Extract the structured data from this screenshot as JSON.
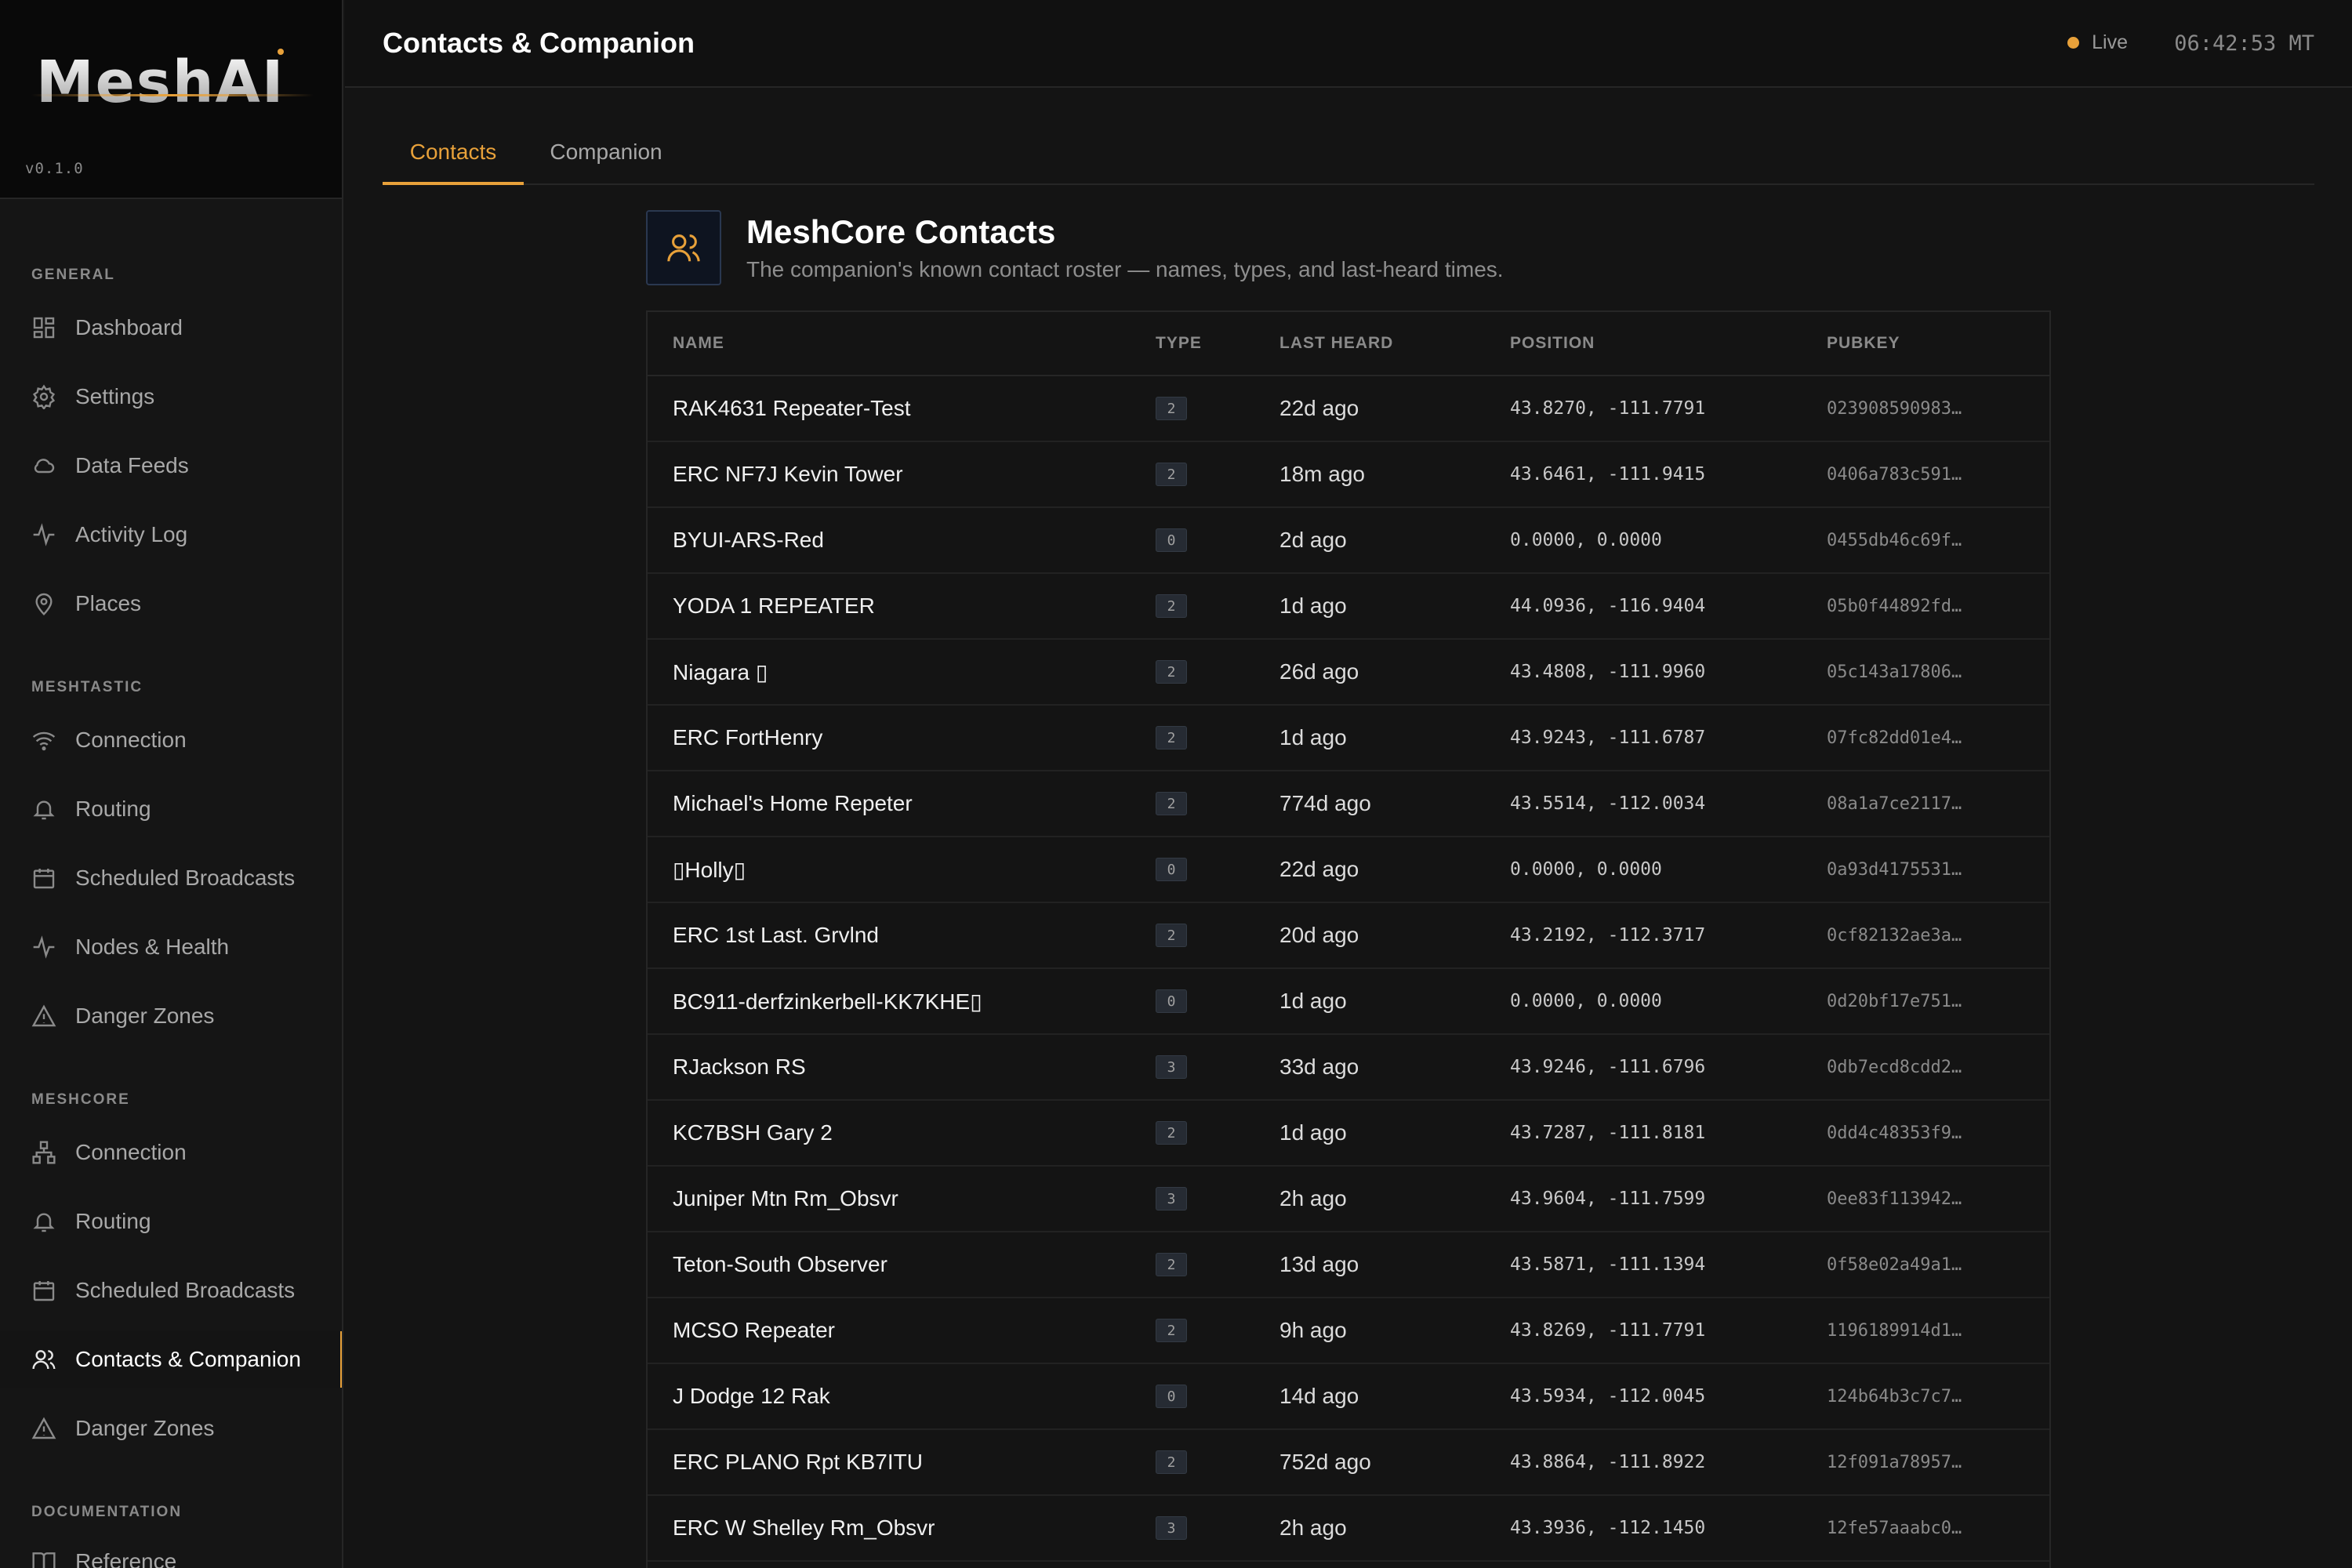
{
  "app": {
    "logo_text": "MeshAI",
    "version": "v0.1.0"
  },
  "sidebar": {
    "sections": [
      {
        "label": "GENERAL",
        "items": [
          {
            "label": "Dashboard",
            "icon": "grid-icon"
          },
          {
            "label": "Settings",
            "icon": "gear-icon"
          },
          {
            "label": "Data Feeds",
            "icon": "cloud-icon"
          },
          {
            "label": "Activity Log",
            "icon": "activity-icon"
          },
          {
            "label": "Places",
            "icon": "map-pin-icon"
          }
        ]
      },
      {
        "label": "MESHTASTIC",
        "items": [
          {
            "label": "Connection",
            "icon": "wifi-icon"
          },
          {
            "label": "Routing",
            "icon": "bell-icon"
          },
          {
            "label": "Scheduled Broadcasts",
            "icon": "calendar-icon"
          },
          {
            "label": "Nodes & Health",
            "icon": "activity-icon"
          },
          {
            "label": "Danger Zones",
            "icon": "warning-icon"
          }
        ]
      },
      {
        "label": "MESHCORE",
        "items": [
          {
            "label": "Connection",
            "icon": "network-icon"
          },
          {
            "label": "Routing",
            "icon": "bell-icon"
          },
          {
            "label": "Scheduled Broadcasts",
            "icon": "calendar-icon"
          },
          {
            "label": "Contacts & Companion",
            "icon": "users-icon",
            "active": true
          },
          {
            "label": "Danger Zones",
            "icon": "warning-icon"
          }
        ]
      },
      {
        "label": "DOCUMENTATION",
        "items": [
          {
            "label": "Reference",
            "icon": "book-icon"
          }
        ]
      }
    ]
  },
  "header": {
    "title": "Contacts & Companion",
    "status": "Live",
    "clock": "06:42:53 MT"
  },
  "tabs": [
    {
      "label": "Contacts",
      "active": true
    },
    {
      "label": "Companion",
      "active": false
    }
  ],
  "section": {
    "title": "MeshCore Contacts",
    "subtitle": "The companion's known contact roster — names, types, and last-heard times."
  },
  "table": {
    "columns": [
      "NAME",
      "TYPE",
      "LAST HEARD",
      "POSITION",
      "PUBKEY"
    ],
    "rows": [
      {
        "name": "RAK4631 Repeater-Test",
        "type": "2",
        "heard": "22d ago",
        "position": "43.8270, -111.7791",
        "pubkey": "023908590983…"
      },
      {
        "name": "ERC NF7J Kevin Tower",
        "type": "2",
        "heard": "18m ago",
        "position": "43.6461, -111.9415",
        "pubkey": "0406a783c591…"
      },
      {
        "name": "BYUI-ARS-Red",
        "type": "0",
        "heard": "2d ago",
        "position": "0.0000, 0.0000",
        "pubkey": "0455db46c69f…"
      },
      {
        "name": "YODA 1 REPEATER",
        "type": "2",
        "heard": "1d ago",
        "position": "44.0936, -116.9404",
        "pubkey": "05b0f44892fd…"
      },
      {
        "name": "Niagara ▯",
        "type": "2",
        "heard": "26d ago",
        "position": "43.4808, -111.9960",
        "pubkey": "05c143a17806…"
      },
      {
        "name": "ERC FortHenry",
        "type": "2",
        "heard": "1d ago",
        "position": "43.9243, -111.6787",
        "pubkey": "07fc82dd01e4…"
      },
      {
        "name": "Michael's Home Repeter",
        "type": "2",
        "heard": "774d ago",
        "position": "43.5514, -112.0034",
        "pubkey": "08a1a7ce2117…"
      },
      {
        "name": "▯Holly▯",
        "type": "0",
        "heard": "22d ago",
        "position": "0.0000, 0.0000",
        "pubkey": "0a93d4175531…"
      },
      {
        "name": "ERC 1st Last. Grvlnd",
        "type": "2",
        "heard": "20d ago",
        "position": "43.2192, -112.3717",
        "pubkey": "0cf82132ae3a…"
      },
      {
        "name": "BC911-derfzinkerbell-KK7KHE▯",
        "type": "0",
        "heard": "1d ago",
        "position": "0.0000, 0.0000",
        "pubkey": "0d20bf17e751…"
      },
      {
        "name": "RJackson RS",
        "type": "3",
        "heard": "33d ago",
        "position": "43.9246, -111.6796",
        "pubkey": "0db7ecd8cdd2…"
      },
      {
        "name": "KC7BSH Gary 2",
        "type": "2",
        "heard": "1d ago",
        "position": "43.7287, -111.8181",
        "pubkey": "0dd4c48353f9…"
      },
      {
        "name": "Juniper Mtn Rm_Obsvr",
        "type": "3",
        "heard": "2h ago",
        "position": "43.9604, -111.7599",
        "pubkey": "0ee83f113942…"
      },
      {
        "name": "Teton-South Observer",
        "type": "2",
        "heard": "13d ago",
        "position": "43.5871, -111.1394",
        "pubkey": "0f58e02a49a1…"
      },
      {
        "name": "MCSO Repeater",
        "type": "2",
        "heard": "9h ago",
        "position": "43.8269, -111.7791",
        "pubkey": "1196189914d1…"
      },
      {
        "name": "J Dodge 12 Rak",
        "type": "0",
        "heard": "14d ago",
        "position": "43.5934, -112.0045",
        "pubkey": "124b64b3c7c7…"
      },
      {
        "name": "ERC PLANO Rpt KB7ITU",
        "type": "2",
        "heard": "752d ago",
        "position": "43.8864, -111.8922",
        "pubkey": "12f091a78957…"
      },
      {
        "name": "ERC W Shelley Rm_Obsvr",
        "type": "3",
        "heard": "2h ago",
        "position": "43.3936, -112.1450",
        "pubkey": "12fe57aaabc0…"
      }
    ]
  },
  "colors": {
    "accent": "#e8a13a",
    "background": "#141414",
    "sidebar": "#151515"
  }
}
